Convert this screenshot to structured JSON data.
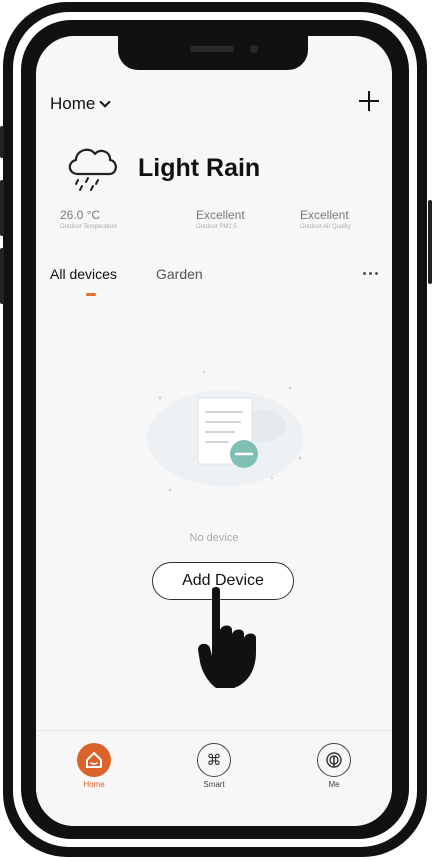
{
  "header": {
    "home_label": "Home",
    "add_icon": "plus-icon"
  },
  "weather": {
    "condition": "Light Rain",
    "icon": "cloud-rain-icon",
    "metrics": [
      {
        "value": "26.0 °C",
        "label": "Outdoor Temperature"
      },
      {
        "value": "Excellent",
        "label": "Outdoor PM2.5"
      },
      {
        "value": "Excellent",
        "label": "Outdoor Air Quality"
      }
    ]
  },
  "tabs": [
    {
      "label": "All devices",
      "active": true
    },
    {
      "label": "Garden",
      "active": false
    }
  ],
  "empty_state": {
    "message": "No device",
    "button_label": "Add Device"
  },
  "bottom_nav": [
    {
      "label": "Home",
      "icon": "house-icon",
      "active": true
    },
    {
      "label": "Smart",
      "icon": "command-icon",
      "active": false
    },
    {
      "label": "Me",
      "icon": "user-icon",
      "active": false
    }
  ],
  "colors": {
    "accent": "#e0702a",
    "text_primary": "#111111",
    "text_muted": "#aaaaaa"
  }
}
